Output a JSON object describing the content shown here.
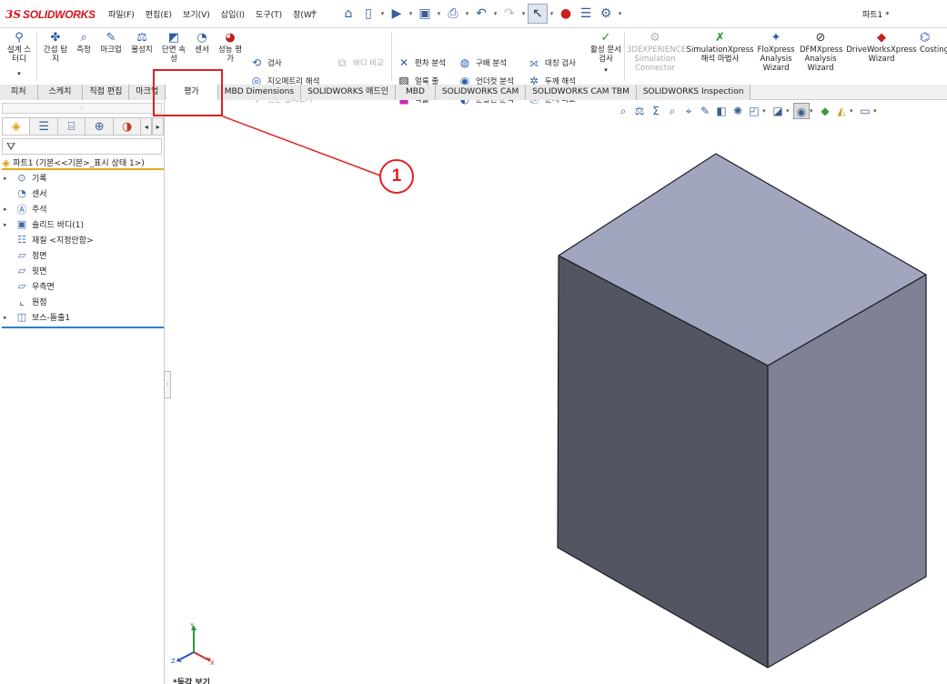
{
  "app": {
    "logo_ds": "3S",
    "logo_name": "SOLIDWORKS",
    "document_title": "파트1 *"
  },
  "menus": [
    "파일(F)",
    "편집(E)",
    "보기(V)",
    "삽입(I)",
    "도구(T)",
    "창(W)"
  ],
  "quick_access": {
    "icons": [
      "home-icon",
      "new-document-icon",
      "open-icon",
      "save-icon",
      "print-icon",
      "undo-icon",
      "redo-icon",
      "select-icon",
      "rebuild-icon",
      "file-properties-icon",
      "options-icon"
    ]
  },
  "ribbon": {
    "design_studio": "설계 스터디",
    "interference": "간섭 탐지",
    "measure": "측정",
    "markup": "마크업",
    "mass_props": "물성치",
    "section_props": "단면 속성",
    "sensor": "센서",
    "performance": "성능 평가",
    "check": "검사",
    "geometry_analysis": "지오메트리 해석",
    "import_diagnostics": "진단 불러오기",
    "compare_bodies": "바디 비교",
    "deviation": "편차 분석",
    "zebra": "얼룩 줄",
    "curvature": "곡률",
    "draft": "구배 분석",
    "undercut": "언더컷 분석",
    "parting_line": "분할선 분석",
    "symmetry": "대칭 검사",
    "thickness": "두께 해석",
    "compare_docs": "문서 비교",
    "active_doc_check": "활성 문서 검사",
    "experience_connector": "3DEXPERIENCE Simulation Connector",
    "simxpress": "SimulationXpress 해석 마법사",
    "floxpress": "FloXpress Analysis Wizard",
    "dfmxpress": "DFMXpress Analysis Wizard",
    "driveworks": "DriveWorksXpress Wizard",
    "costing": "Costing"
  },
  "tabs": [
    "피처",
    "스케치",
    "직접 편집",
    "마크업",
    "평가",
    "MBD Dimensions",
    "SOLIDWORKS 애드인",
    "MBD",
    "SOLIDWORKS CAM",
    "SOLIDWORKS CAM TBM",
    "SOLIDWORKS Inspection"
  ],
  "active_tab": "평가",
  "feature_tree": {
    "root": "파트1  (기본<<기본>_표시 상태 1>)",
    "nodes": [
      {
        "label": "기록",
        "icon": "history-icon",
        "expandable": true
      },
      {
        "label": "센서",
        "icon": "sensor-icon",
        "expandable": false
      },
      {
        "label": "주석",
        "icon": "annotation-icon",
        "expandable": true
      },
      {
        "label": "솔리드 바디(1)",
        "icon": "solid-body-icon",
        "expandable": true
      },
      {
        "label": "재질 <지정안함>",
        "icon": "material-icon",
        "expandable": false
      },
      {
        "label": "정면",
        "icon": "plane-icon",
        "expandable": false
      },
      {
        "label": "윗면",
        "icon": "plane-icon",
        "expandable": false
      },
      {
        "label": "우측면",
        "icon": "plane-icon",
        "expandable": false
      },
      {
        "label": "원점",
        "icon": "origin-icon",
        "expandable": false
      },
      {
        "label": "보스-돌출1",
        "icon": "extrude-icon",
        "expandable": true
      }
    ]
  },
  "viewport": {
    "view_label": "*등각 보기",
    "colors": {
      "top": "#a2a5be",
      "left": "#535563",
      "right": "#7f8195",
      "edge": "#1c1c22"
    }
  },
  "annotation": {
    "number": "1",
    "color": "#e02020"
  }
}
